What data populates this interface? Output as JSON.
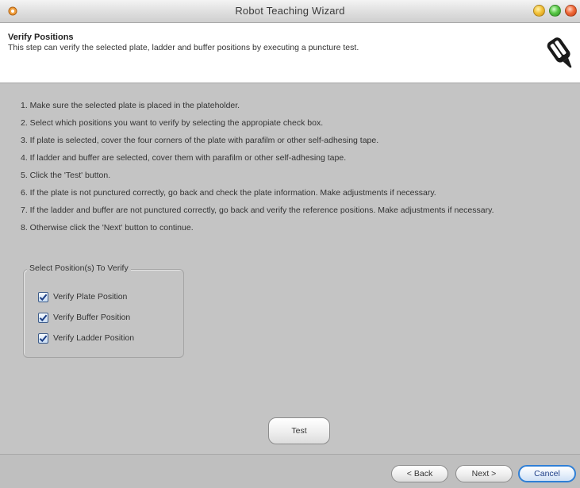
{
  "window": {
    "title": "Robot Teaching Wizard",
    "app_icon": "app-icon",
    "controls": [
      "minimize",
      "maximize",
      "close"
    ]
  },
  "header": {
    "title": "Verify Positions",
    "description": "This step can verify the selected plate, ladder and buffer positions  by executing a puncture test.",
    "icon": "pipette-icon"
  },
  "instructions": [
    "1.  Make sure the selected plate is placed in the plateholder.",
    "2.  Select which positions you want to verify by selecting the appropiate check box.",
    "3.  If plate is selected, cover the four corners of the plate with parafilm or other self-adhesing tape.",
    "4.  If ladder and buffer are selected, cover them with parafilm or other self-adhesing tape.",
    "5.  Click the 'Test' button.",
    "6. If the plate is not punctured correctly, go back and check the plate information.  Make adjustments if necessary.",
    "7.  If the ladder and buffer are not punctured correctly, go back and verify the reference positions.  Make adjustments if necessary.",
    "8.  Otherwise click the 'Next' button to continue."
  ],
  "positions_group": {
    "legend": "Select Position(s) To Verify",
    "checkboxes": [
      {
        "label": "Verify Plate Position",
        "checked": true
      },
      {
        "label": "Verify Buffer Position",
        "checked": true
      },
      {
        "label": "Verify Ladder Position",
        "checked": true
      }
    ]
  },
  "buttons": {
    "test": "Test",
    "back": "< Back",
    "next": "Next >",
    "cancel": "Cancel"
  },
  "colors": {
    "window_bg": "#c4c4c4",
    "header_bg": "#ffffff",
    "default_button_border": "#2f7fd6"
  }
}
